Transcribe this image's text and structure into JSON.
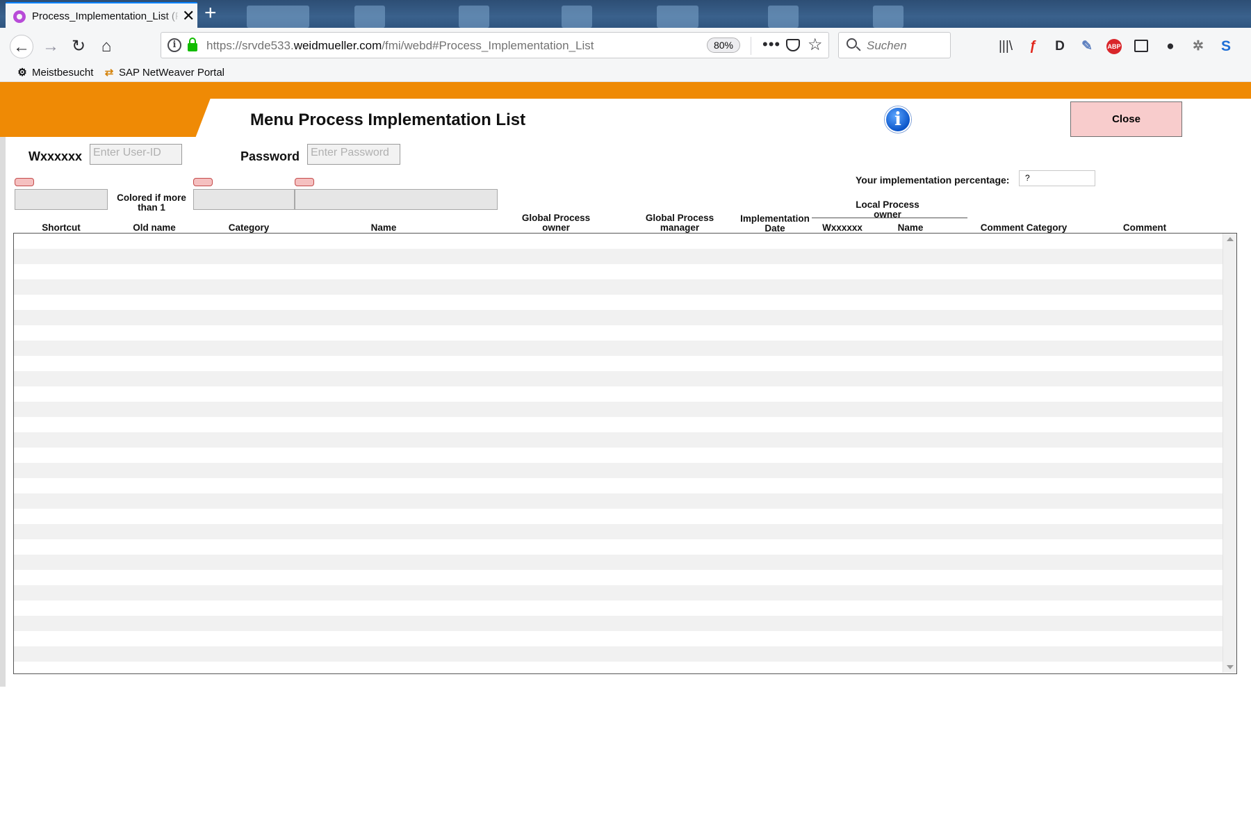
{
  "browser": {
    "tab_title": "Process_Implementation_List (F",
    "tab_close": "✕",
    "new_tab": "+",
    "url_prefix": "https://srvde533.",
    "url_domain": "weidmueller.com",
    "url_path": "/fmi/webd#Process_Implementation_List",
    "zoom": "80%",
    "more": "•••",
    "star": "☆",
    "search_placeholder": "Suchen",
    "nav_icons": [
      "back-arrow-icon",
      "forward-arrow-icon",
      "reload-icon",
      "home-icon"
    ],
    "toolbar_icons": [
      "library-icon",
      "acrobat-icon",
      "dashlane-icon",
      "screenshot-icon",
      "adblock-icon",
      "sidebar-icon",
      "extension-icon",
      "settings-icon",
      "skype-icon"
    ],
    "bookmarks": [
      {
        "label": "Meistbesucht",
        "icon": "gear-icon"
      },
      {
        "label": "SAP NetWeaver Portal",
        "icon": "sap-portal-icon"
      }
    ]
  },
  "page": {
    "title": "Menu Process Implementation List",
    "info_glyph": "i",
    "close_label": "Close",
    "user_label": "Wxxxxxx",
    "user_placeholder": "Enter User-ID",
    "password_label": "Password",
    "password_placeholder": "Enter Password",
    "colored_note_line1": "Colored if more",
    "colored_note_line2": "than 1",
    "percentage_label": "Your implementation percentage:",
    "percentage_value": "?"
  },
  "table": {
    "headers": {
      "shortcut": "Shortcut",
      "old_name": "Old name",
      "category": "Category",
      "name": "Name",
      "gpo_1": "Global Process",
      "gpo_2": "owner",
      "gpm_1": "Global Process",
      "gpm_2": "manager",
      "impl_1": "Implementation",
      "impl_2": "Date",
      "lpo_1": "Local Process",
      "lpo_2": "owner",
      "lpo_user": "Wxxxxxx",
      "lpo_name": "Name",
      "comment_category": "Comment Category",
      "comment": "Comment"
    },
    "rows": []
  },
  "colors": {
    "accent_orange": "#ef8a05",
    "close_button": "#f8cccc",
    "info_blue": "#0b55c9"
  }
}
